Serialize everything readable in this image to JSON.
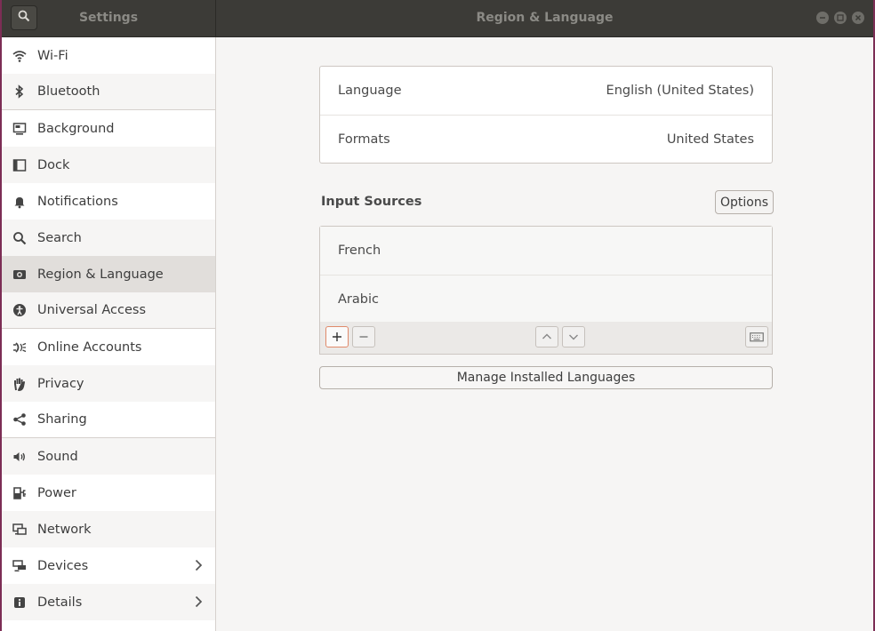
{
  "window": {
    "sidebar_title": "Settings",
    "panel_title": "Region & Language",
    "accent_color": "#e95420"
  },
  "sidebar": {
    "items": [
      {
        "label": "Wi-Fi",
        "icon": "wifi-icon"
      },
      {
        "label": "Bluetooth",
        "icon": "bluetooth-icon"
      },
      {
        "label": "Background",
        "icon": "background-icon"
      },
      {
        "label": "Dock",
        "icon": "dock-icon"
      },
      {
        "label": "Notifications",
        "icon": "bell-icon"
      },
      {
        "label": "Search",
        "icon": "search-icon"
      },
      {
        "label": "Region & Language",
        "icon": "region-icon",
        "selected": true
      },
      {
        "label": "Universal Access",
        "icon": "accessibility-icon"
      },
      {
        "label": "Online Accounts",
        "icon": "online-accounts-icon"
      },
      {
        "label": "Privacy",
        "icon": "hand-icon"
      },
      {
        "label": "Sharing",
        "icon": "share-icon"
      },
      {
        "label": "Sound",
        "icon": "speaker-icon"
      },
      {
        "label": "Power",
        "icon": "power-icon"
      },
      {
        "label": "Network",
        "icon": "network-icon"
      },
      {
        "label": "Devices",
        "icon": "devices-icon"
      },
      {
        "label": "Details",
        "icon": "info-icon"
      }
    ]
  },
  "main": {
    "language": {
      "label": "Language",
      "value": "English (United States)"
    },
    "formats": {
      "label": "Formats",
      "value": "United States"
    },
    "input_sources_title": "Input Sources",
    "options_label": "Options",
    "sources": [
      "French",
      "Arabic"
    ],
    "manage_label": "Manage Installed Languages"
  }
}
